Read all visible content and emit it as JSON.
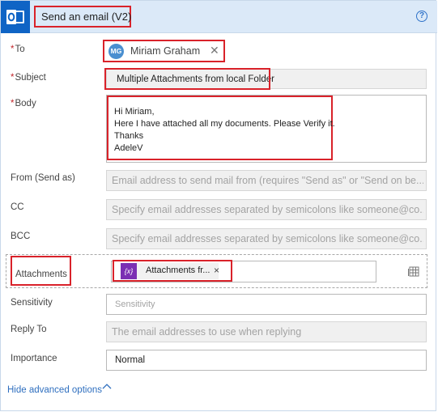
{
  "header": {
    "title": "Send an email (V2)",
    "help_glyph": "?",
    "app_icon": "outlook-icon",
    "accent_color": "#0f64c5"
  },
  "fields": {
    "to": {
      "label": "To",
      "required_mark": "*",
      "chip_initials": "MG",
      "chip_name": "Miriam Graham",
      "remove_glyph": "✕"
    },
    "subject": {
      "label": "Subject",
      "required_mark": "*",
      "value": "Multiple Attachments from local Folder"
    },
    "body": {
      "label": "Body",
      "required_mark": "*",
      "lines": [
        "Hi Miriam,",
        "Here I have attached all my documents. Please Verify it.",
        "Thanks",
        "AdeleV"
      ]
    },
    "from": {
      "label": "From (Send as)",
      "placeholder": "Email address to send mail from (requires \"Send as\" or \"Send on be..."
    },
    "cc": {
      "label": "CC",
      "placeholder": "Specify email addresses separated by semicolons like someone@co..."
    },
    "bcc": {
      "label": "BCC",
      "placeholder": "Specify email addresses separated by semicolons like someone@co..."
    },
    "attachments": {
      "label": "Attachments",
      "token_icon_text": "{x}",
      "token_label": "Attachments fr...",
      "remove_glyph": "×"
    },
    "sensitivity": {
      "label": "Sensitivity",
      "placeholder": "Sensitivity"
    },
    "reply_to": {
      "label": "Reply To",
      "placeholder": "The email addresses to use when replying"
    },
    "importance": {
      "label": "Importance",
      "value": "Normal"
    }
  },
  "footer": {
    "hide_advanced": "Hide advanced options",
    "chevron": "^"
  },
  "colors": {
    "header_bg": "#dbe9f8",
    "highlight_red": "#d9222a",
    "link_blue": "#2f6fbf",
    "token_purple": "#7b2fb3",
    "avatar_blue": "#4a8fd0"
  }
}
